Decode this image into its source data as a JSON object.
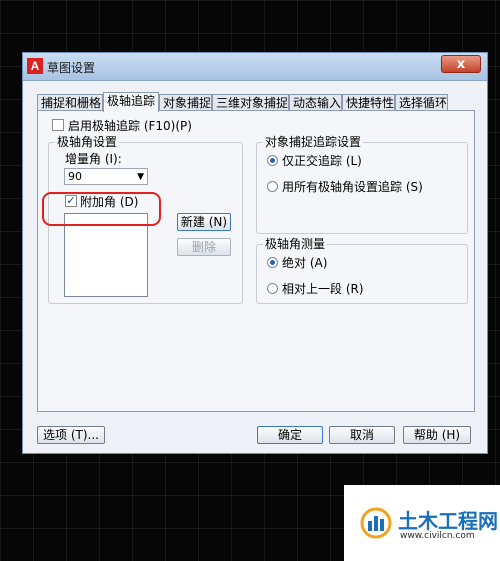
{
  "window": {
    "title": "草图设置",
    "logo_letter": "A",
    "close_label": "x"
  },
  "tabs": [
    {
      "label": "捕捉和栅格"
    },
    {
      "label": "极轴追踪",
      "active": true
    },
    {
      "label": "对象捕捉"
    },
    {
      "label": "三维对象捕捉"
    },
    {
      "label": "动态输入"
    },
    {
      "label": "快捷特性"
    },
    {
      "label": "选择循环"
    }
  ],
  "polar": {
    "enable_label": "启用极轴追踪 (F10)(P)",
    "enable_checked": false,
    "angle_group": {
      "title": "极轴角设置",
      "increment_label": "增量角 (I):",
      "increment_value": "90",
      "additional_label": "附加角 (D)",
      "additional_checked": true,
      "new_button": "新建 (N)",
      "delete_button": "删除"
    },
    "snap_group": {
      "title": "对象捕捉追踪设置",
      "option1": "仅正交追踪 (L)",
      "option2": "用所有极轴角设置追踪 (S)",
      "selected": 1
    },
    "measure_group": {
      "title": "极轴角测量",
      "option1": "绝对 (A)",
      "option2": "相对上一段 (R)",
      "selected": 1
    }
  },
  "footer": {
    "options_button": "选项 (T)...",
    "ok_button": "确定",
    "cancel_button": "取消",
    "help_button": "帮助 (H)"
  },
  "watermark": {
    "name": "土木工程网",
    "url": "www.civilcn.com"
  },
  "colors": {
    "titlebar": "#b6cde9",
    "close": "#c7432a",
    "highlight": "#e22222",
    "brand": "#1a6fb8"
  }
}
